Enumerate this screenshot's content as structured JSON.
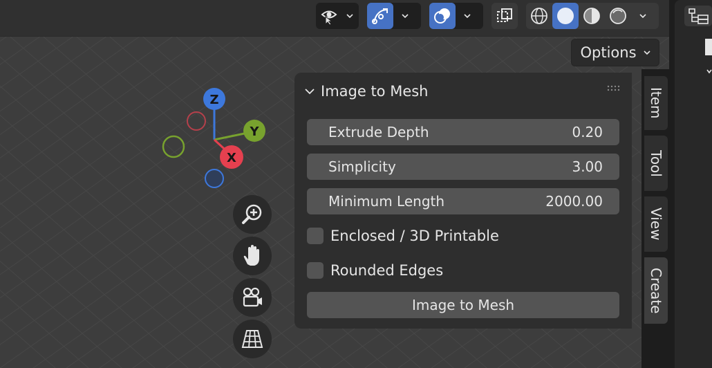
{
  "header": {
    "options_label": "Options"
  },
  "gizmo": {
    "x_label": "X",
    "y_label": "Y",
    "z_label": "Z"
  },
  "panel": {
    "title": "Image to Mesh",
    "fields": [
      {
        "label": "Extrude Depth",
        "value": "0.20"
      },
      {
        "label": "Simplicity",
        "value": "3.00"
      },
      {
        "label": "Minimum Length",
        "value": "2000.00"
      }
    ],
    "checkboxes": [
      {
        "label": "Enclosed / 3D Printable",
        "checked": false
      },
      {
        "label": "Rounded Edges",
        "checked": false
      }
    ],
    "action_label": "Image to Mesh"
  },
  "tabs": [
    {
      "label": "Item"
    },
    {
      "label": "Tool"
    },
    {
      "label": "View"
    },
    {
      "label": "Create",
      "active": true
    }
  ],
  "colors": {
    "accent": "#4672c4",
    "axis_x": "#e5404f",
    "axis_y": "#78a22e",
    "axis_z": "#3d78dc"
  }
}
